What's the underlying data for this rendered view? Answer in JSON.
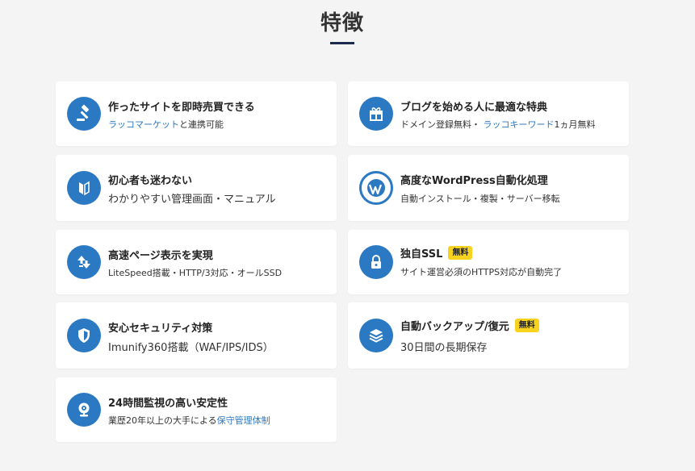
{
  "section": {
    "title": "特徴"
  },
  "features": [
    {
      "icon": "gavel-icon",
      "title": "作ったサイトを即時売買できる",
      "desc_link": "ラッコマーケット",
      "desc_text": "と連携可能"
    },
    {
      "icon": "gift-icon",
      "title": "ブログを始める人に最適な特典",
      "desc_prefix": "ドメイン登録無料・",
      "desc_link": "ラッコキーワード",
      "desc_text": "1ヵ月無料"
    },
    {
      "icon": "beginner-mark-icon",
      "title": "初心者も迷わない",
      "desc_text": "わかりやすい管理画面・マニュアル"
    },
    {
      "icon": "wordpress-icon",
      "title": "高度なWordPress自動化処理",
      "desc_text": "自動インストール・複製・サーバー移転"
    },
    {
      "icon": "speed-arrows-icon",
      "title": "高速ページ表示を実現",
      "desc_text": "LiteSpeed搭載・HTTP/3対応・オールSSD"
    },
    {
      "icon": "lock-icon",
      "title": "独自SSL",
      "badge": "無料",
      "desc_text": "サイト運営必須のHTTPS対応が自動完了"
    },
    {
      "icon": "shield-icon",
      "title": "安心セキュリティ対策",
      "desc_text": "Imunify360搭載（WAF/IPS/IDS）"
    },
    {
      "icon": "layers-icon",
      "title": "自動バックアップ/復元",
      "badge": "無料",
      "desc_text": "30日間の長期保存"
    },
    {
      "icon": "webcam-icon",
      "title": "24時間監視の高い安定性",
      "desc_text": "業歴20年以上の大手による",
      "desc_link": "保守管理体制"
    }
  ],
  "colors": {
    "icon_bg": "#2b79c2",
    "link": "#2b79c2",
    "badge_bg": "#f7d21e",
    "title_underline": "#1b2a4a",
    "page_bg": "#f4f4f4"
  }
}
